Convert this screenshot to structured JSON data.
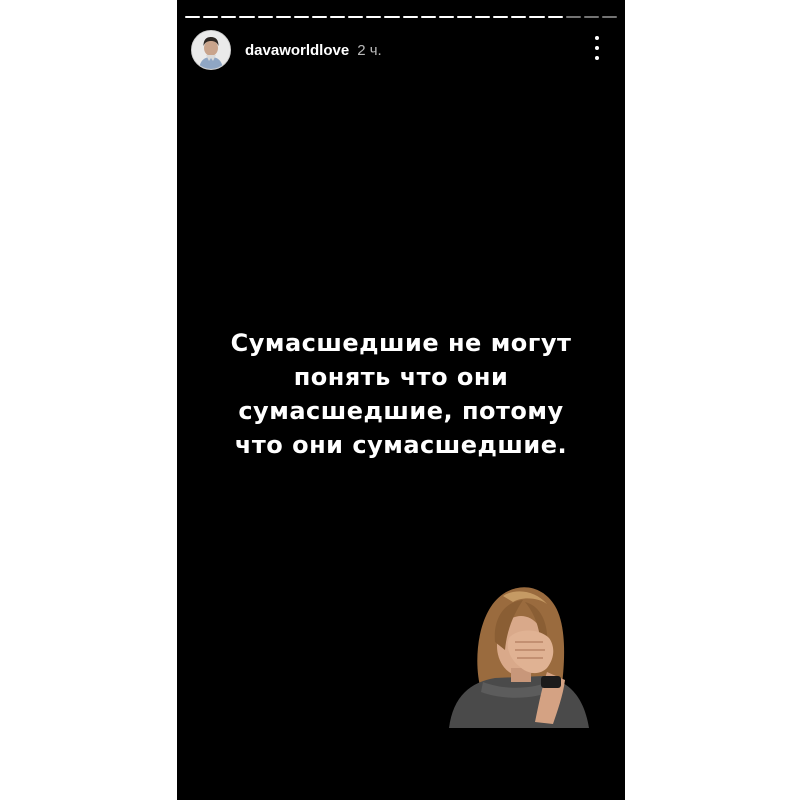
{
  "story": {
    "progress_segments_total": 24,
    "progress_segments_done": 21,
    "header": {
      "username": "davaworldlove",
      "time": "2 ч."
    },
    "menu_icon": "more-vertical-icon",
    "caption_lines": [
      "Сумасшедшие не могут",
      "понять что они",
      "сумасшедшие, потому",
      "что они сумасшедшие."
    ],
    "sticker": "facepalm-sticker"
  },
  "colors": {
    "background": "#000000",
    "text": "#ffffff",
    "page": "#ffffff"
  }
}
